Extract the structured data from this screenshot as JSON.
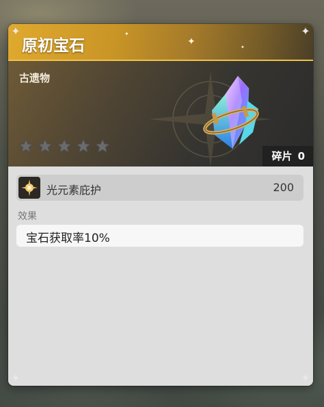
{
  "item": {
    "title": "原初宝石",
    "category": "古遗物",
    "stars_total": 5,
    "stars_filled": 0,
    "fragment_label": "碎片",
    "fragment_count": "0"
  },
  "element": {
    "icon": "light-element-icon",
    "name": "光元素庇护",
    "value": "200"
  },
  "effect": {
    "label": "效果",
    "text": "宝石获取率10%"
  },
  "colors": {
    "gold": "#d9a42c",
    "card": "#dcdcdc"
  }
}
